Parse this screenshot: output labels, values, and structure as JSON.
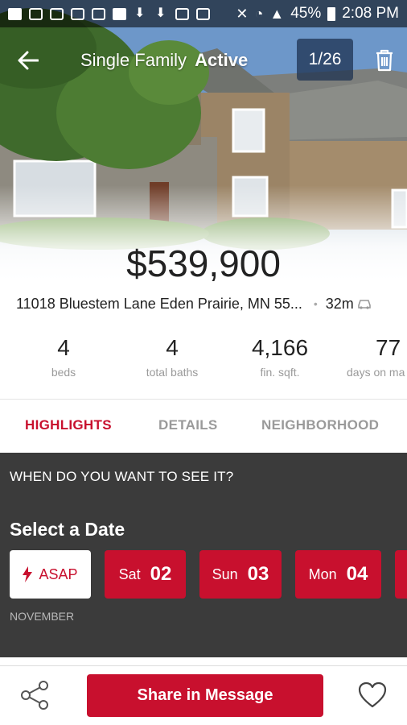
{
  "status_bar": {
    "battery_percent": "45%",
    "time": "2:08 PM"
  },
  "toolbar": {
    "type": "Single Family",
    "status": "Active",
    "photo_counter": "1/26"
  },
  "listing": {
    "price": "$539,900",
    "address": "11018 Bluestem Lane Eden Prairie, MN 55...",
    "drive_time": "32m"
  },
  "stats": [
    {
      "value": "4",
      "label": "beds"
    },
    {
      "value": "4",
      "label": "total baths"
    },
    {
      "value": "4,166",
      "label": "fin. sqft."
    },
    {
      "value": "77",
      "label": "days on ma"
    }
  ],
  "tabs": [
    {
      "label": "HIGHLIGHTS",
      "active": true
    },
    {
      "label": "DETAILS",
      "active": false
    },
    {
      "label": "NEIGHBORHOOD",
      "active": false
    }
  ],
  "scheduler": {
    "question": "WHEN DO YOU WANT TO SEE IT?",
    "heading": "Select a Date",
    "asap_label": "ASAP",
    "days": [
      {
        "name": "Sat",
        "num": "02"
      },
      {
        "name": "Sun",
        "num": "03"
      },
      {
        "name": "Mon",
        "num": "04"
      }
    ],
    "month": "NOVEMBER"
  },
  "bottom": {
    "share_label": "Share in Message"
  },
  "colors": {
    "accent": "#c8102e",
    "panel": "#3b3b3b",
    "muted_text": "#9a9a9a"
  },
  "icons": [
    "back-arrow-icon",
    "trash-icon",
    "car-icon",
    "lightning-icon",
    "share-icon",
    "heart-icon"
  ]
}
